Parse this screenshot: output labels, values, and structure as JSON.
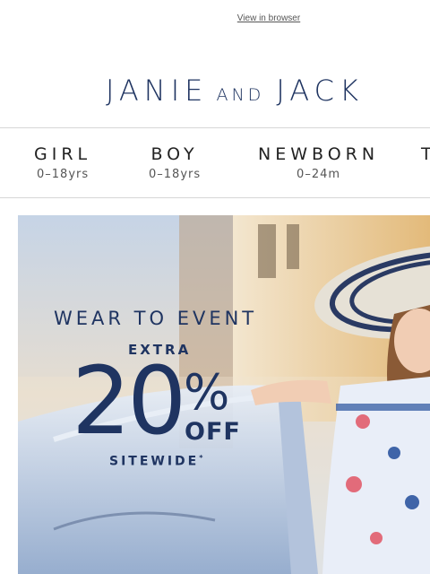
{
  "header": {
    "view_in_browser": "View in browser",
    "brand_main_1": "JANIE",
    "brand_small": "AND",
    "brand_main_2": "JACK"
  },
  "nav": [
    {
      "label": "GIRL",
      "sub": "0–18yrs"
    },
    {
      "label": "BOY",
      "sub": "0–18yrs"
    },
    {
      "label": "NEWBORN",
      "sub": "0–24m"
    },
    {
      "label": "T",
      "sub": ""
    }
  ],
  "hero": {
    "headline": "WEAR TO EVENT",
    "extra": "EXTRA",
    "percent": "20",
    "percent_sign": "%",
    "off": "OFF",
    "sitewide": "SITEWIDE",
    "sitewide_mark": "*"
  },
  "colors": {
    "brand_navy": "#1f3461",
    "border": "#d7d7d7"
  }
}
